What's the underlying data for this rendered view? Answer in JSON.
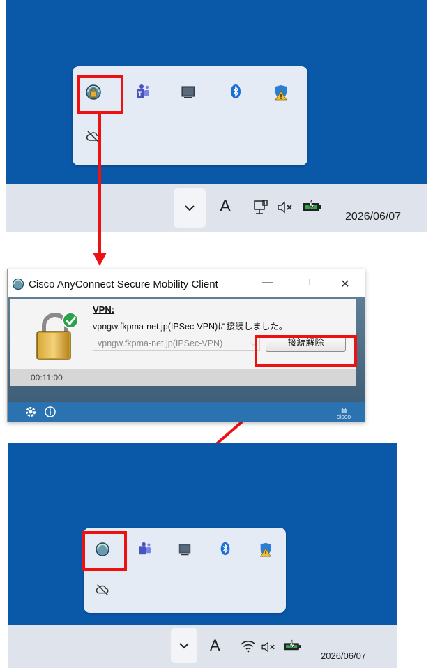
{
  "top_screen": {
    "tray_icons": [
      "cisco-anyconnect-locked-icon",
      "teams-icon",
      "display-icon",
      "bluetooth-icon",
      "windows-security-warning-icon",
      "cloud-off-icon"
    ],
    "taskbar": {
      "input_indicator": "A",
      "date": "2026/06/07",
      "icons": [
        "chevron-up-icon",
        "network-cable-icon",
        "volume-muted-icon",
        "battery-charging-icon"
      ]
    }
  },
  "dialog": {
    "title": "Cisco AnyConnect Secure Mobility Client",
    "window_buttons": {
      "minimize": "—",
      "maximize": "□",
      "close": "✕"
    },
    "vpn_label": "VPN:",
    "status": "vpngw.fkpma-net.jp(IPSec-VPN)に接続しました。",
    "server_select": "vpngw.fkpma-net.jp(IPSec-VPN)",
    "disconnect_button": "接続解除",
    "timer": "00:11:00",
    "brand": "cisco"
  },
  "bottom_screen": {
    "tray_icons": [
      "cisco-anyconnect-icon",
      "teams-icon",
      "display-icon",
      "bluetooth-icon",
      "windows-security-warning-icon",
      "cloud-off-icon"
    ],
    "taskbar": {
      "input_indicator": "A",
      "date": "2026/06/07",
      "icons": [
        "chevron-up-icon",
        "wifi-icon",
        "volume-muted-icon",
        "battery-charging-icon"
      ]
    }
  },
  "colors": {
    "desktop_blue": "#0a58a8",
    "highlight_red": "#ee1111",
    "taskbar_bg": "#dfe4ec",
    "tray_popup_bg": "#e4ebf4"
  }
}
